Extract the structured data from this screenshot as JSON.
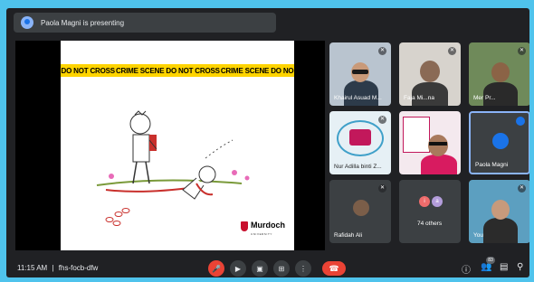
{
  "banner": {
    "presenter_text": "Paola Magni is presenting"
  },
  "slide": {
    "tape_texts": [
      "DO NOT CROSS",
      "CRIME SCENE DO NOT CROSS",
      "CRIME SCENE DO NO"
    ],
    "logo_name": "Murdoch",
    "logo_sub": "UNIVERSITY"
  },
  "participants": [
    {
      "name": "Khairul Asuad M..."
    },
    {
      "name": "Faja Mi...na"
    },
    {
      "name": "Mer Pr..."
    },
    {
      "name": "Nur Adilla binti Z..."
    },
    {
      "name": ""
    },
    {
      "name": "Paola Magni"
    },
    {
      "name": "Rafidah Ali"
    },
    {
      "name": "74 others",
      "avatars": [
        "i",
        "a"
      ]
    },
    {
      "name": "You"
    }
  ],
  "bottombar": {
    "time": "11:15 AM",
    "separator": "|",
    "meeting_code": "fhs-focb-dfw",
    "people_count": "83"
  },
  "colors": {
    "background": "#4fc3ec",
    "window": "#202124",
    "tile": "#3c4043",
    "red": "#ea4335",
    "tape": "#ffd400",
    "active_border": "#8ab4f8"
  },
  "icons": [
    "presenting-icon",
    "mic-off-icon",
    "camera-icon",
    "captions-icon",
    "present-icon",
    "more-icon",
    "end-call-icon",
    "info-icon",
    "people-icon",
    "chat-icon",
    "activities-icon"
  ]
}
